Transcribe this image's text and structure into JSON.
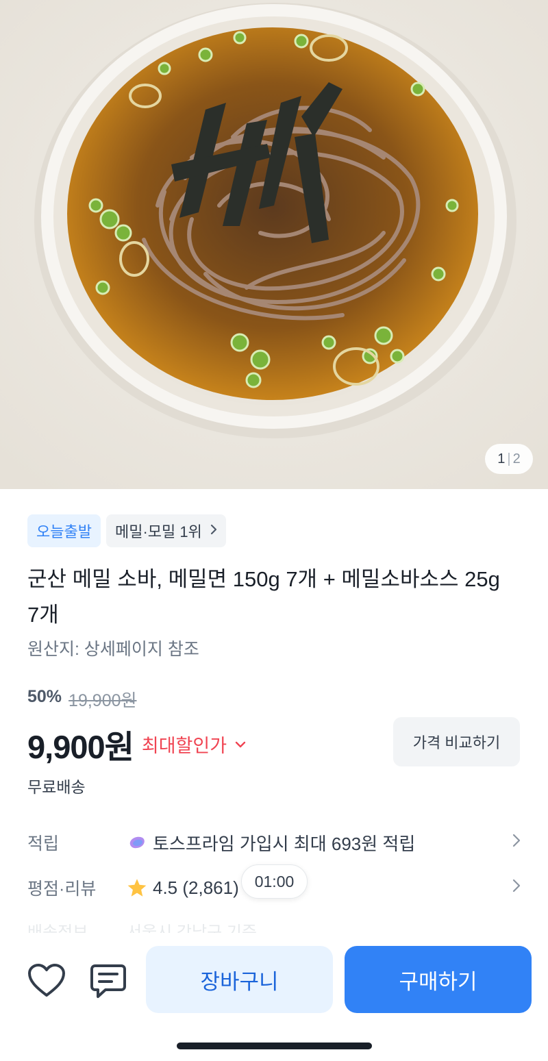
{
  "hero": {
    "image_alt": "soba noodle bowl photo",
    "counter_current": "1",
    "counter_sep": "|",
    "counter_total": "2"
  },
  "badges": {
    "today_ship": "오늘출발",
    "rank": "메밀·모밀 1위"
  },
  "product": {
    "title": "군산 메밀 소바, 메밀면 150g 7개 + 메밀소바소스 25g 7개",
    "origin": "원산지: 상세페이지 참조",
    "discount_rate": "50%",
    "original_price": "19,900원",
    "price": "9,900원",
    "max_discount_label": "최대할인가",
    "compare_label": "가격 비교하기",
    "shipping": "무료배송"
  },
  "info": {
    "points_label": "적립",
    "points_value": "토스프라임 가입시 최대 693원 적립",
    "rating_label": "평점·리뷰",
    "rating_value": "4.5 (2,861)",
    "faded_label": "배송정보",
    "faded_value": "서울시 강남구 기준"
  },
  "timer": "01:00",
  "actions": {
    "cart": "장바구니",
    "buy": "구매하기"
  },
  "colors": {
    "accent": "#3182f6",
    "discount_red": "#f04452",
    "cart_bg": "#e8f3ff"
  }
}
